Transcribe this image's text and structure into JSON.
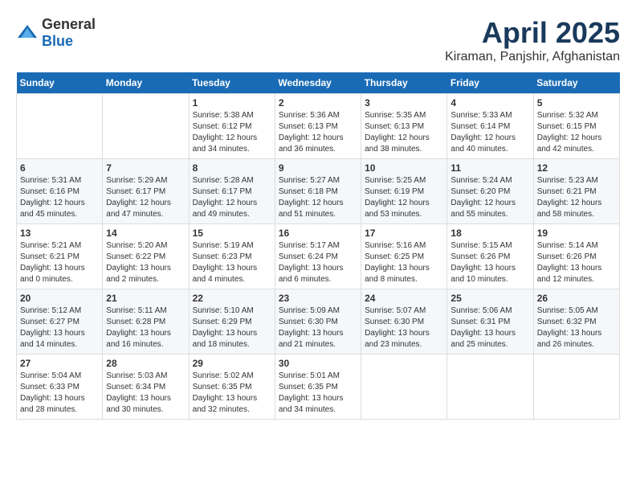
{
  "header": {
    "logo_general": "General",
    "logo_blue": "Blue",
    "title": "April 2025",
    "subtitle": "Kiraman, Panjshir, Afghanistan"
  },
  "columns": [
    "Sunday",
    "Monday",
    "Tuesday",
    "Wednesday",
    "Thursday",
    "Friday",
    "Saturday"
  ],
  "weeks": [
    {
      "cells": [
        {
          "day": "",
          "empty": true
        },
        {
          "day": "",
          "empty": true
        },
        {
          "day": "1",
          "sunrise": "Sunrise: 5:38 AM",
          "sunset": "Sunset: 6:12 PM",
          "daylight": "Daylight: 12 hours and 34 minutes."
        },
        {
          "day": "2",
          "sunrise": "Sunrise: 5:36 AM",
          "sunset": "Sunset: 6:13 PM",
          "daylight": "Daylight: 12 hours and 36 minutes."
        },
        {
          "day": "3",
          "sunrise": "Sunrise: 5:35 AM",
          "sunset": "Sunset: 6:13 PM",
          "daylight": "Daylight: 12 hours and 38 minutes."
        },
        {
          "day": "4",
          "sunrise": "Sunrise: 5:33 AM",
          "sunset": "Sunset: 6:14 PM",
          "daylight": "Daylight: 12 hours and 40 minutes."
        },
        {
          "day": "5",
          "sunrise": "Sunrise: 5:32 AM",
          "sunset": "Sunset: 6:15 PM",
          "daylight": "Daylight: 12 hours and 42 minutes."
        }
      ]
    },
    {
      "cells": [
        {
          "day": "6",
          "sunrise": "Sunrise: 5:31 AM",
          "sunset": "Sunset: 6:16 PM",
          "daylight": "Daylight: 12 hours and 45 minutes."
        },
        {
          "day": "7",
          "sunrise": "Sunrise: 5:29 AM",
          "sunset": "Sunset: 6:17 PM",
          "daylight": "Daylight: 12 hours and 47 minutes."
        },
        {
          "day": "8",
          "sunrise": "Sunrise: 5:28 AM",
          "sunset": "Sunset: 6:17 PM",
          "daylight": "Daylight: 12 hours and 49 minutes."
        },
        {
          "day": "9",
          "sunrise": "Sunrise: 5:27 AM",
          "sunset": "Sunset: 6:18 PM",
          "daylight": "Daylight: 12 hours and 51 minutes."
        },
        {
          "day": "10",
          "sunrise": "Sunrise: 5:25 AM",
          "sunset": "Sunset: 6:19 PM",
          "daylight": "Daylight: 12 hours and 53 minutes."
        },
        {
          "day": "11",
          "sunrise": "Sunrise: 5:24 AM",
          "sunset": "Sunset: 6:20 PM",
          "daylight": "Daylight: 12 hours and 55 minutes."
        },
        {
          "day": "12",
          "sunrise": "Sunrise: 5:23 AM",
          "sunset": "Sunset: 6:21 PM",
          "daylight": "Daylight: 12 hours and 58 minutes."
        }
      ]
    },
    {
      "cells": [
        {
          "day": "13",
          "sunrise": "Sunrise: 5:21 AM",
          "sunset": "Sunset: 6:21 PM",
          "daylight": "Daylight: 13 hours and 0 minutes."
        },
        {
          "day": "14",
          "sunrise": "Sunrise: 5:20 AM",
          "sunset": "Sunset: 6:22 PM",
          "daylight": "Daylight: 13 hours and 2 minutes."
        },
        {
          "day": "15",
          "sunrise": "Sunrise: 5:19 AM",
          "sunset": "Sunset: 6:23 PM",
          "daylight": "Daylight: 13 hours and 4 minutes."
        },
        {
          "day": "16",
          "sunrise": "Sunrise: 5:17 AM",
          "sunset": "Sunset: 6:24 PM",
          "daylight": "Daylight: 13 hours and 6 minutes."
        },
        {
          "day": "17",
          "sunrise": "Sunrise: 5:16 AM",
          "sunset": "Sunset: 6:25 PM",
          "daylight": "Daylight: 13 hours and 8 minutes."
        },
        {
          "day": "18",
          "sunrise": "Sunrise: 5:15 AM",
          "sunset": "Sunset: 6:26 PM",
          "daylight": "Daylight: 13 hours and 10 minutes."
        },
        {
          "day": "19",
          "sunrise": "Sunrise: 5:14 AM",
          "sunset": "Sunset: 6:26 PM",
          "daylight": "Daylight: 13 hours and 12 minutes."
        }
      ]
    },
    {
      "cells": [
        {
          "day": "20",
          "sunrise": "Sunrise: 5:12 AM",
          "sunset": "Sunset: 6:27 PM",
          "daylight": "Daylight: 13 hours and 14 minutes."
        },
        {
          "day": "21",
          "sunrise": "Sunrise: 5:11 AM",
          "sunset": "Sunset: 6:28 PM",
          "daylight": "Daylight: 13 hours and 16 minutes."
        },
        {
          "day": "22",
          "sunrise": "Sunrise: 5:10 AM",
          "sunset": "Sunset: 6:29 PM",
          "daylight": "Daylight: 13 hours and 18 minutes."
        },
        {
          "day": "23",
          "sunrise": "Sunrise: 5:09 AM",
          "sunset": "Sunset: 6:30 PM",
          "daylight": "Daylight: 13 hours and 21 minutes."
        },
        {
          "day": "24",
          "sunrise": "Sunrise: 5:07 AM",
          "sunset": "Sunset: 6:30 PM",
          "daylight": "Daylight: 13 hours and 23 minutes."
        },
        {
          "day": "25",
          "sunrise": "Sunrise: 5:06 AM",
          "sunset": "Sunset: 6:31 PM",
          "daylight": "Daylight: 13 hours and 25 minutes."
        },
        {
          "day": "26",
          "sunrise": "Sunrise: 5:05 AM",
          "sunset": "Sunset: 6:32 PM",
          "daylight": "Daylight: 13 hours and 26 minutes."
        }
      ]
    },
    {
      "cells": [
        {
          "day": "27",
          "sunrise": "Sunrise: 5:04 AM",
          "sunset": "Sunset: 6:33 PM",
          "daylight": "Daylight: 13 hours and 28 minutes."
        },
        {
          "day": "28",
          "sunrise": "Sunrise: 5:03 AM",
          "sunset": "Sunset: 6:34 PM",
          "daylight": "Daylight: 13 hours and 30 minutes."
        },
        {
          "day": "29",
          "sunrise": "Sunrise: 5:02 AM",
          "sunset": "Sunset: 6:35 PM",
          "daylight": "Daylight: 13 hours and 32 minutes."
        },
        {
          "day": "30",
          "sunrise": "Sunrise: 5:01 AM",
          "sunset": "Sunset: 6:35 PM",
          "daylight": "Daylight: 13 hours and 34 minutes."
        },
        {
          "day": "",
          "empty": true
        },
        {
          "day": "",
          "empty": true
        },
        {
          "day": "",
          "empty": true
        }
      ]
    }
  ]
}
